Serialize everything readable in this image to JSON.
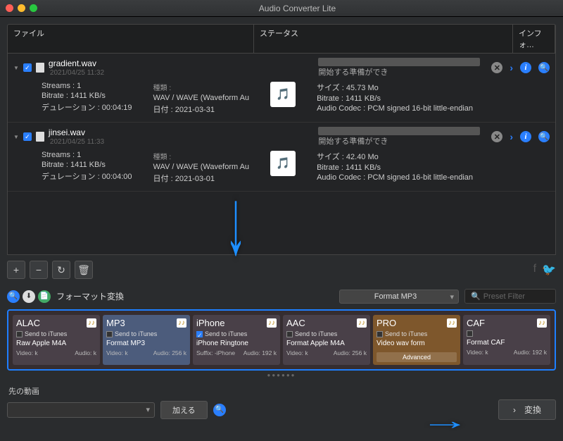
{
  "window": {
    "title": "Audio Converter Lite"
  },
  "columns": {
    "file": "ファイル",
    "status": "ステータス",
    "info": "インフォ…"
  },
  "files": [
    {
      "name": "gradient.wav",
      "date": "2021/04/25 11:32",
      "status": "開始する準備ができ",
      "streams": "Streams : 1",
      "bitrate": "Bitrate : 1411 KB/s",
      "duration": "デュレーション : 00:04:19",
      "kind_label": "種類 :",
      "kind": "WAV / WAVE (Waveform Au",
      "file_date": "日付 : 2021-03-31",
      "size": "サイズ : 45.73 Mo",
      "bitrate2": "Bitrate : 1411 KB/s",
      "codec": "Audio Codec : PCM signed 16-bit little-endian"
    },
    {
      "name": "jinsei.wav",
      "date": "2021/04/25 11:33",
      "status": "開始する準備ができ",
      "streams": "Streams : 1",
      "bitrate": "Bitrate : 1411 KB/s",
      "duration": "デュレーション : 00:04:00",
      "kind_label": "種類 :",
      "kind": "WAV / WAVE (Waveform Au",
      "file_date": "日付 : 2021-03-01",
      "size": "サイズ : 42.40 Mo",
      "bitrate2": "Bitrate : 1411 KB/s",
      "codec": "Audio Codec : PCM signed 16-bit little-endian"
    }
  ],
  "format_section": {
    "label": "フォーマット変換",
    "selected": "Format MP3",
    "filter_placeholder": "Preset Filter"
  },
  "cards": [
    {
      "title": "ALAC",
      "send": "Send to iTunes",
      "checked": false,
      "desc": "Raw Apple M4A",
      "video": "Video:",
      "audio": "Audio:",
      "vval": "k",
      "aval": "k"
    },
    {
      "title": "MP3",
      "send": "Send to iTunes",
      "checked": false,
      "desc": "Format MP3",
      "video": "Video:",
      "audio": "Audio:",
      "vval": "k",
      "aval": "256   k"
    },
    {
      "title": "iPhone",
      "send": "Send to iTunes",
      "checked": true,
      "desc": "iPhone Ringtone",
      "video": "Suffix:",
      "audio": "Audio:",
      "vval": "-iPhone",
      "aval": "192   k"
    },
    {
      "title": "AAC",
      "send": "Send to iTunes",
      "checked": false,
      "desc": "Format Apple M4A",
      "video": "Video:",
      "audio": "Audio:",
      "vval": "k",
      "aval": "256   k"
    },
    {
      "title": "PRO",
      "send": "Send to iTunes",
      "checked": false,
      "desc": "Video wav form",
      "advanced": "Advanced"
    },
    {
      "title": "CAF",
      "send": "",
      "checked": false,
      "desc": "Format CAF",
      "video": "Video:",
      "audio": "Audio:",
      "vval": "k",
      "aval": "192   k"
    }
  ],
  "dest": {
    "label": "先の動画",
    "add": "加える"
  },
  "convert": {
    "label": "変換"
  },
  "pager_dots": "●●●●●●"
}
